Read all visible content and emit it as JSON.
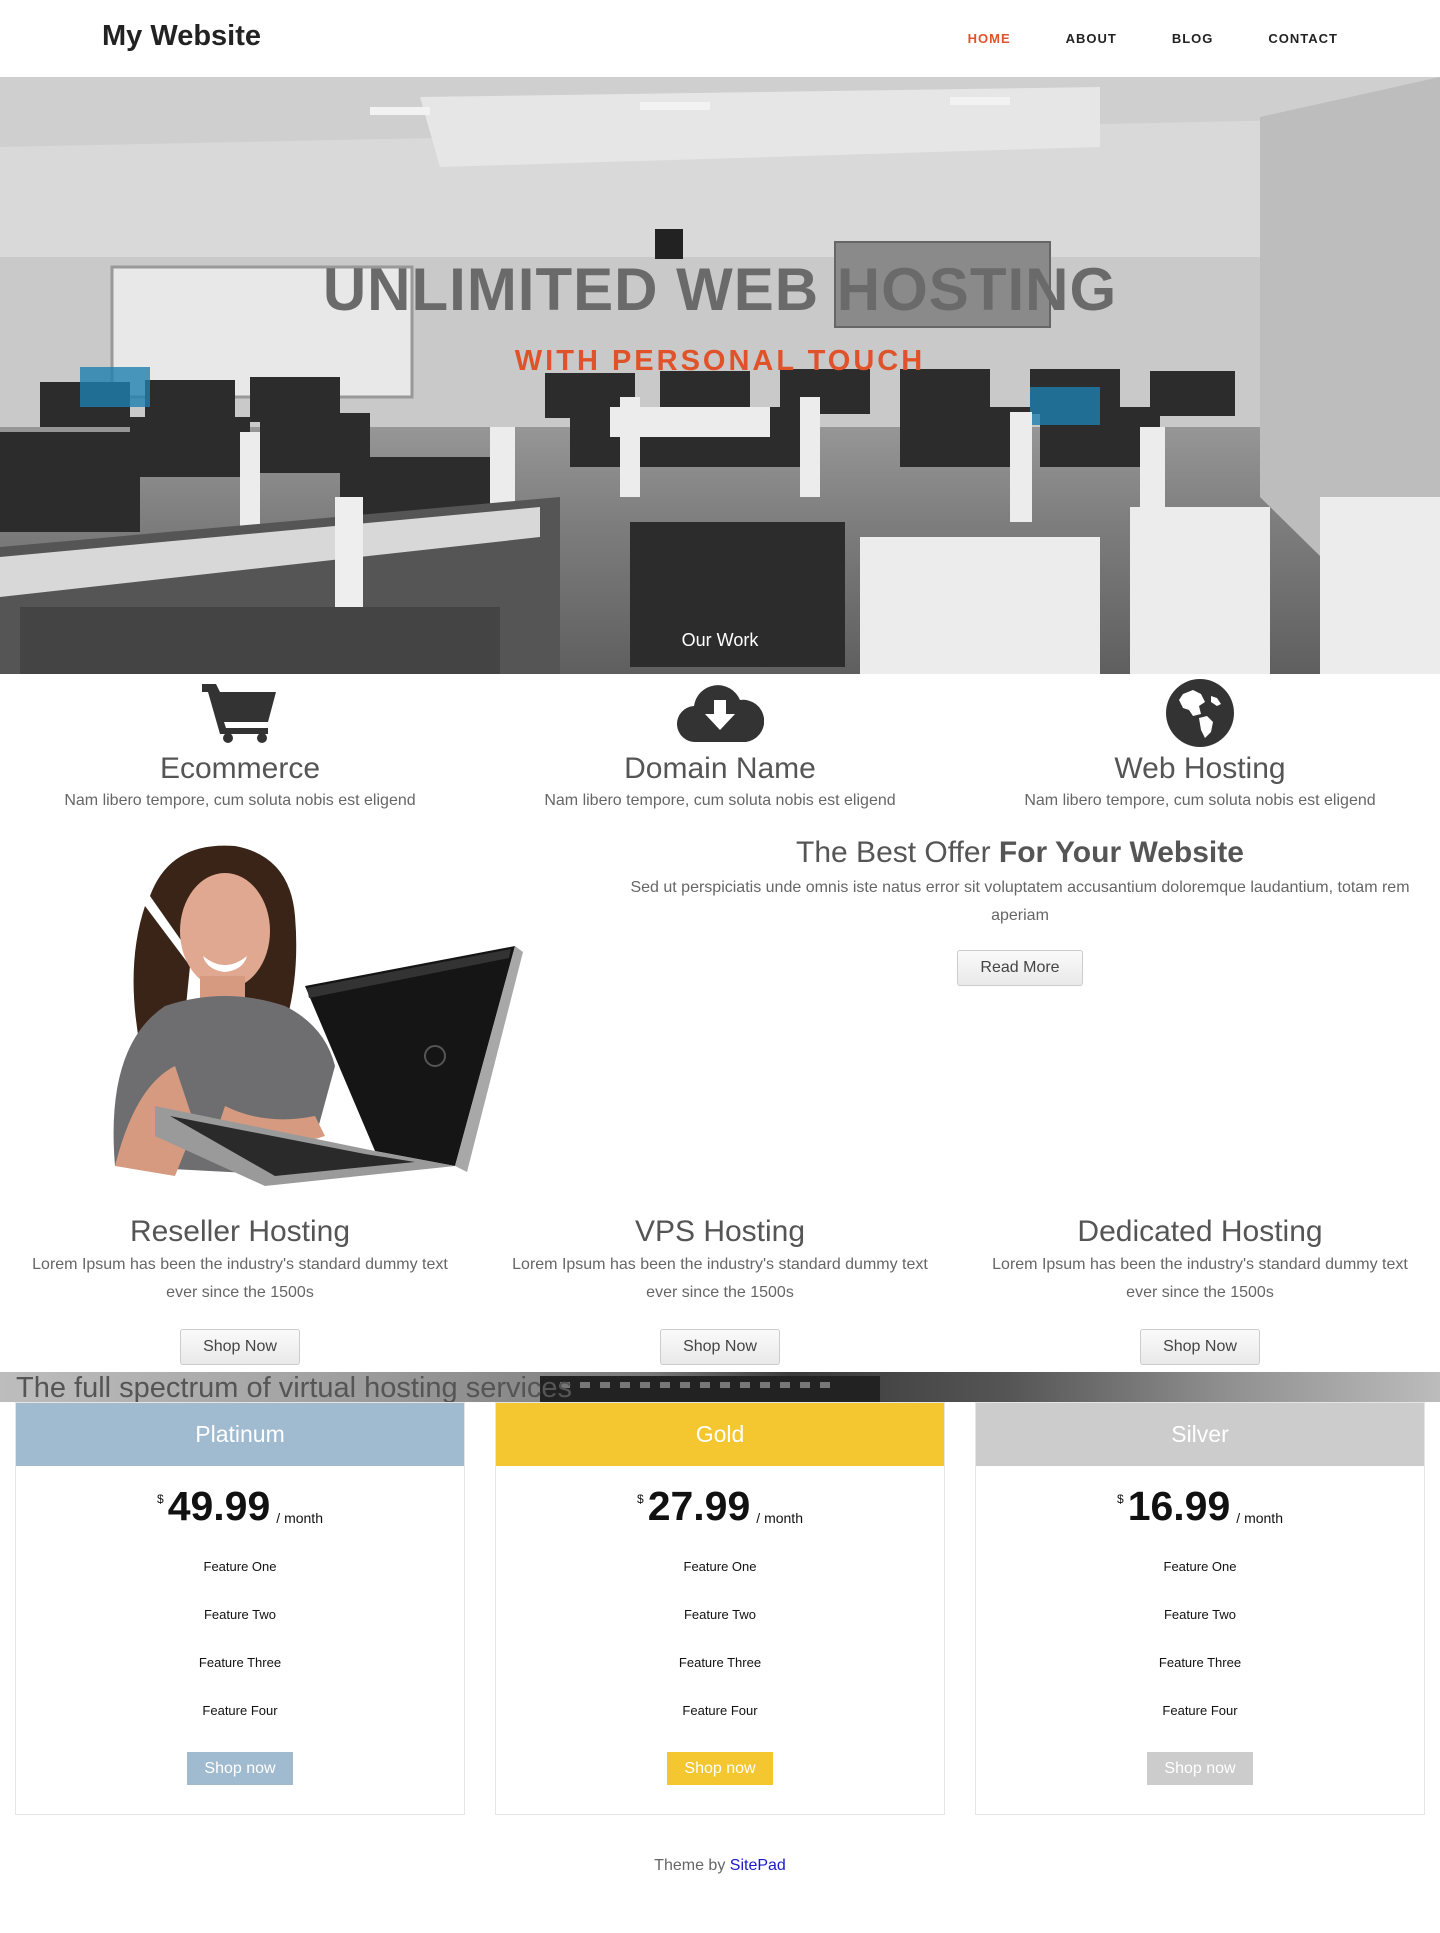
{
  "site": {
    "title": "My Website"
  },
  "nav": [
    {
      "label": "HOME",
      "active": true
    },
    {
      "label": "ABOUT",
      "active": false
    },
    {
      "label": "BLOG",
      "active": false
    },
    {
      "label": "CONTACT",
      "active": false
    }
  ],
  "hero": {
    "title": "UNLIMITED WEB HOSTING",
    "subtitle": "WITH PERSONAL TOUCH",
    "link": "Our Work"
  },
  "features": [
    {
      "icon": "cart-icon",
      "title": "Ecommerce",
      "text": "Nam libero tempore, cum soluta nobis est eligend"
    },
    {
      "icon": "cloud-download-icon",
      "title": "Domain Name",
      "text": "Nam libero tempore, cum soluta nobis est eligend"
    },
    {
      "icon": "globe-icon",
      "title": "Web Hosting",
      "text": "Nam libero tempore, cum soluta nobis est eligend"
    }
  ],
  "offer": {
    "title_plain": "The Best Offer ",
    "title_bold": "For Your Website",
    "text": "Sed ut perspiciatis unde omnis iste natus error sit voluptatem accusantium doloremque laudantium, totam rem aperiam",
    "button": "Read More"
  },
  "hostings": [
    {
      "title": "Reseller Hosting",
      "text": "Lorem Ipsum has been the industry's standard dummy text ever since the 1500s",
      "button": "Shop Now"
    },
    {
      "title": "VPS Hosting",
      "text": "Lorem Ipsum has been the industry's standard dummy text ever since the 1500s",
      "button": "Shop Now"
    },
    {
      "title": "Dedicated Hosting",
      "text": "Lorem Ipsum has been the industry's standard dummy text ever since the 1500s",
      "button": "Shop Now"
    }
  ],
  "strip": {
    "text": "The full spectrum of virtual hosting services"
  },
  "pricing": [
    {
      "name": "Platinum",
      "currency": "$",
      "price": "49.99",
      "period": "/ month",
      "color": "#a0bad0",
      "features": [
        "Feature One",
        "Feature Two",
        "Feature Three",
        "Feature Four"
      ],
      "button": "Shop now"
    },
    {
      "name": "Gold",
      "currency": "$",
      "price": "27.99",
      "period": "/ month",
      "color": "#f4c630",
      "features": [
        "Feature One",
        "Feature Two",
        "Feature Three",
        "Feature Four"
      ],
      "button": "Shop now"
    },
    {
      "name": "Silver",
      "currency": "$",
      "price": "16.99",
      "period": "/ month",
      "color": "#cccccc",
      "features": [
        "Feature One",
        "Feature Two",
        "Feature Three",
        "Feature Four"
      ],
      "button": "Shop now"
    }
  ],
  "footer": {
    "prefix": "Theme by ",
    "link": "SitePad"
  },
  "colors": {
    "accent": "#e0532a",
    "link": "#1a1acc"
  }
}
